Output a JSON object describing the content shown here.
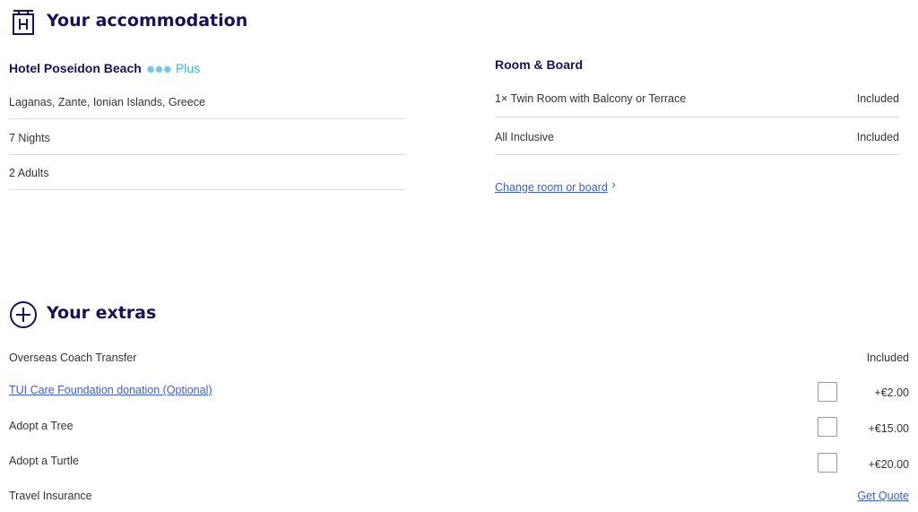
{
  "accommodation": {
    "section_title": "Your accommodation",
    "hotel_name": "Hotel Poseidon Beach",
    "stars": "✺✺✺",
    "rating_suffix": "Plus",
    "details": [
      "Laganas, Zante, Ionian Islands, Greece",
      "7 Nights",
      "2  Adults"
    ]
  },
  "room_board": {
    "title": "Room & Board",
    "items": [
      {
        "label": "1× Twin Room with Balcony or Terrace",
        "value": "Included"
      },
      {
        "label": "All Inclusive",
        "value": "Included"
      }
    ],
    "change_link": "Change room or board",
    "chevron": "›"
  },
  "extras": {
    "section_title": "Your extras",
    "items": [
      {
        "label": "Overseas Coach Transfer",
        "value": "Included"
      },
      {
        "label": "TUI Care Foundation donation (Optional)",
        "value": "+€2.00"
      },
      {
        "label": "Adopt a Tree",
        "value": "+€15.00"
      },
      {
        "label": "Adopt a Turtle",
        "value": "+€20.00"
      },
      {
        "label": "Travel Insurance",
        "value": "Get Quote"
      }
    ]
  },
  "colors": {
    "brand": "#1a115a",
    "link": "#3c5ec8",
    "star": "#73c5e8",
    "divider": "#dcdcdc"
  }
}
